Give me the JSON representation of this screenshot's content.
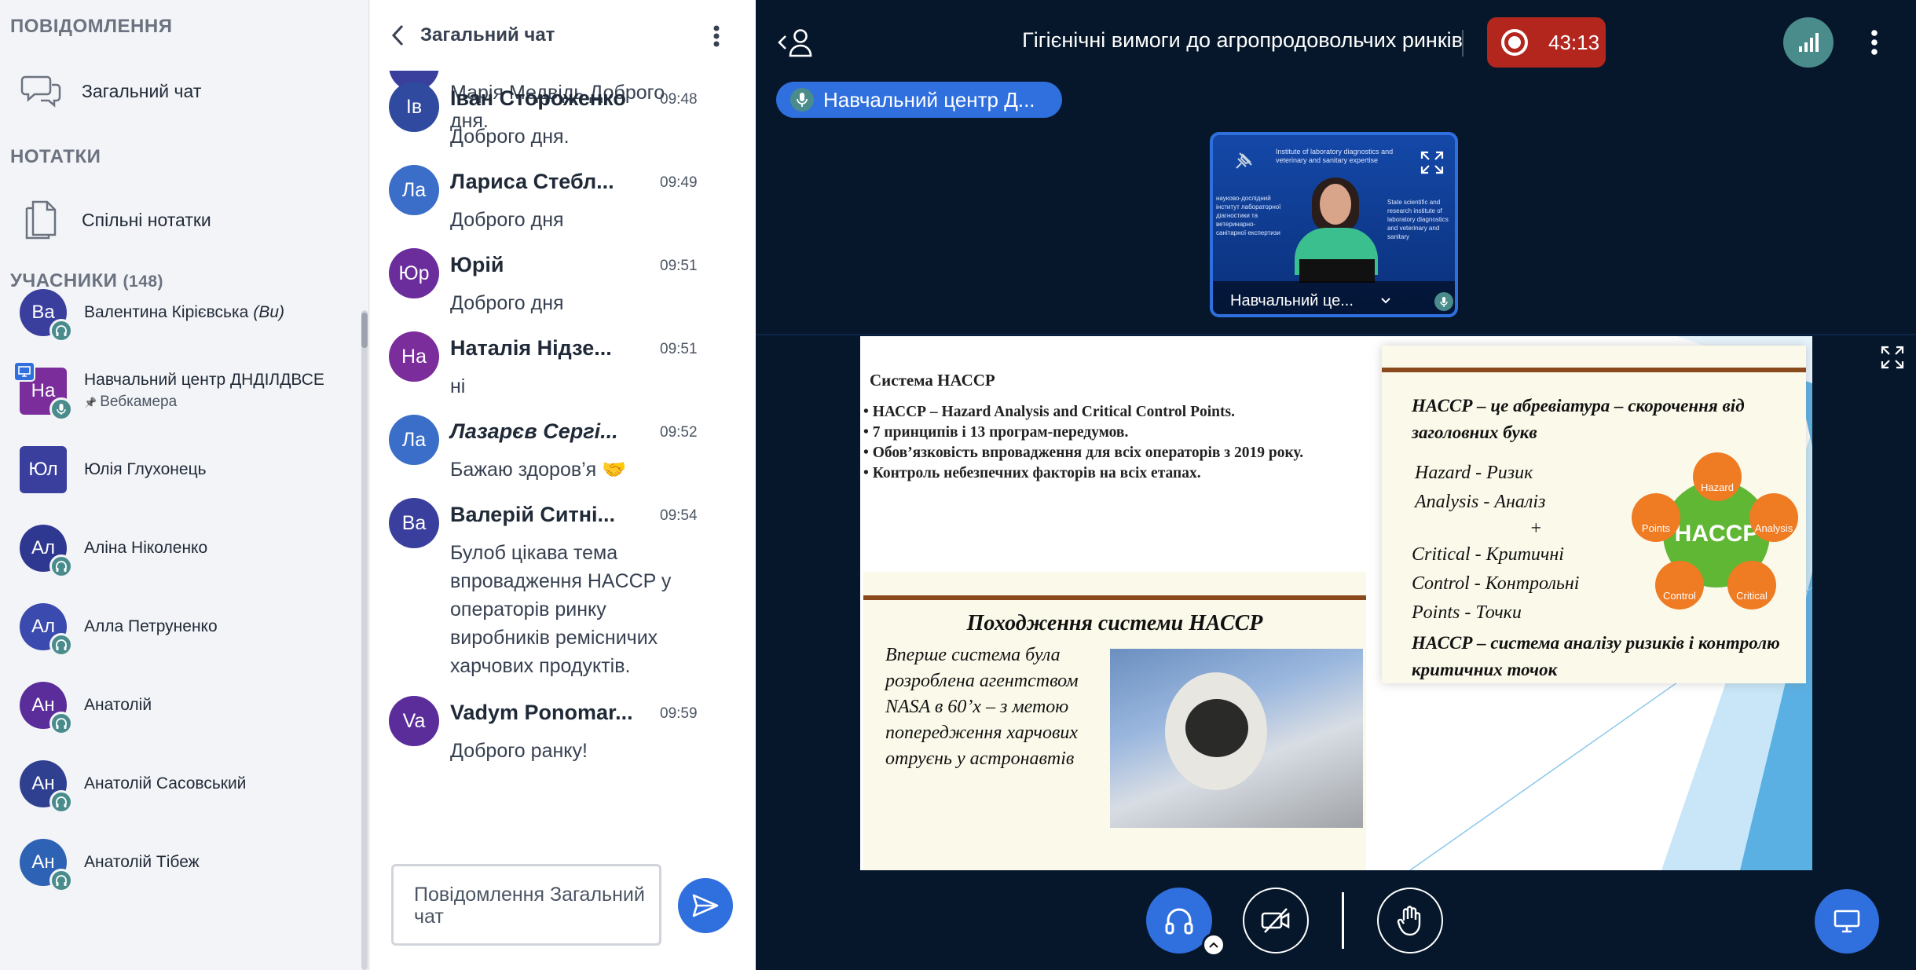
{
  "sidebar": {
    "messages_title": "ПОВІДОМЛЕННЯ",
    "general_chat": "Загальний чат",
    "notes_title": "НОТАТКИ",
    "shared_notes": "Спільні нотатки",
    "participants_title": "УЧАСНИКИ",
    "participants_count": "(148)",
    "participants": [
      {
        "initials": "Ва",
        "name": "Валентина Кірієвська",
        "suffix": "(Ви)",
        "color": "#3a3f9e"
      },
      {
        "initials": "На",
        "name": "Навчальний центр ДНДІЛДВСЕ",
        "sub": "Вебкамера",
        "color": "#7a2d9b"
      },
      {
        "initials": "Юл",
        "name": "Юлія Глухонець",
        "color": "#3a3f9e"
      },
      {
        "initials": "Ал",
        "name": "Аліна Ніколенко",
        "color": "#2f3890"
      },
      {
        "initials": "Ал",
        "name": "Алла Петруненко",
        "color": "#3a4aae"
      },
      {
        "initials": "Ан",
        "name": "Анатолій",
        "color": "#5a2d9b"
      },
      {
        "initials": "Ан",
        "name": "Анатолій Сасовський",
        "color": "#2f4090"
      },
      {
        "initials": "Ан",
        "name": "Анатолій Тібеж",
        "color": "#2d62b4"
      }
    ]
  },
  "chat": {
    "title": "Загальний чат",
    "partial_message": "Марія Медвідь.Доброго дня.",
    "messages": [
      {
        "initials": "Ів",
        "name": "Іван Стороженко",
        "time": "09:48",
        "text": "Доброго дня.",
        "color": "#2f4a9e"
      },
      {
        "initials": "Ла",
        "name": "Лариса Стебл...",
        "time": "09:49",
        "text": "Доброго дня",
        "color": "#3a6ec8"
      },
      {
        "initials": "Юр",
        "name": "Юрій",
        "time": "09:51",
        "text": "Доброго дня",
        "color": "#6b2d9b"
      },
      {
        "initials": "На",
        "name": "Наталія Нідзе...",
        "time": "09:51",
        "text": "ні",
        "color": "#7a2d9b"
      },
      {
        "initials": "Ла",
        "name": "Лазарєв Сергі...",
        "time": "09:52",
        "text": "Бажаю здоров’я 🤝",
        "color": "#3a6ec8"
      },
      {
        "initials": "Ва",
        "name": "Валерій Ситні...",
        "time": "09:54",
        "text": "Булоб цікава тема впровадження HACCP у операторів ринку виробників ремісничих харчових продуктів.",
        "color": "#3a3f9e"
      },
      {
        "initials": "Va",
        "name": "Vadym Ponomar...",
        "time": "09:59",
        "text": "Доброго ранку!",
        "color": "#5a2d9b"
      }
    ],
    "composer_placeholder": "Повідомлення Загальний чат"
  },
  "stage": {
    "meeting_title": "Гігієнічні вимоги до агропродовольчих ринків",
    "recording_time": "43:13",
    "presenter_label": "Навчальний центр Д...",
    "webcam_label": "Навчальний це...",
    "accent": "#2f6fde",
    "record_color": "#b3261e"
  },
  "slide": {
    "title": "Система НАССР",
    "bullets": [
      "НАССР – Hazard Analysis and Critical Control Points.",
      "7 принципів і 13 програм-передумов.",
      "Обов’язковість впровадження для всіх операторів з 2019 року.",
      "Контроль небезпечних факторів на всіх етапах."
    ],
    "abbr_heading": "НАССР – це абревіатура – скорочення від заголовних букв",
    "abbr_lines": [
      "Hazard - Ризик",
      "Analysis - Аналіз",
      "+",
      "Critical - Критичні",
      "Control - Контрольні",
      "Points - Точки"
    ],
    "abbr_footer": "НАССР – система аналізу ризиків і контролю критичних точок",
    "wheel_center": "HACCP",
    "wheel_items": [
      "Hazard",
      "Analysis",
      "Critical",
      "Control",
      "Points"
    ],
    "origin_heading": "Походження системи НАССР",
    "origin_text": "Вперше система була розроблена агентством NASA в 60’х – з метою попередження харчових отруєнь у астронавтів",
    "webcam_banner_1": "Institute of laboratory diagnostics and veterinary and sanitary expertise",
    "webcam_banner_2": "науково-дослідний інститут лабораторної діагностики та ветеринарно-санітарної експертизи",
    "webcam_banner_3": "State scientific and research institute of laboratory diagnostics and veterinary and sanitary"
  }
}
